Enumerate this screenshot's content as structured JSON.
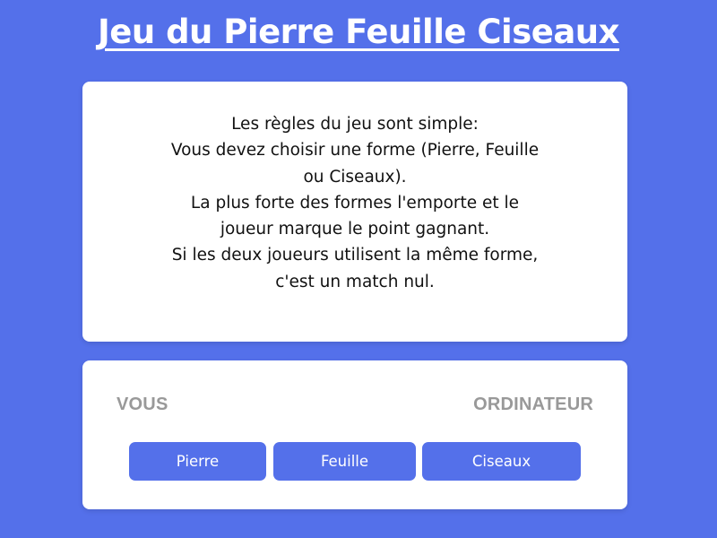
{
  "header": {
    "title": "Jeu du Pierre Feuille Ciseaux"
  },
  "rules": {
    "lines": [
      "Les règles du jeu sont simple:",
      "Vous devez choisir une forme (Pierre, Feuille",
      "ou Ciseaux).",
      "La plus forte des formes l'emporte et le",
      "joueur marque le point gagnant.",
      "Si les deux joueurs utilisent la même forme,",
      "c'est un match nul."
    ]
  },
  "game": {
    "player_label": "VOUS",
    "computer_label": "ORDINATEUR",
    "choices": {
      "rock": "Pierre",
      "paper": "Feuille",
      "scissors": "Ciseaux"
    }
  },
  "colors": {
    "background": "#5470EA",
    "button": "#5470EA",
    "card": "#FFFFFF",
    "label_gray": "#999999"
  }
}
